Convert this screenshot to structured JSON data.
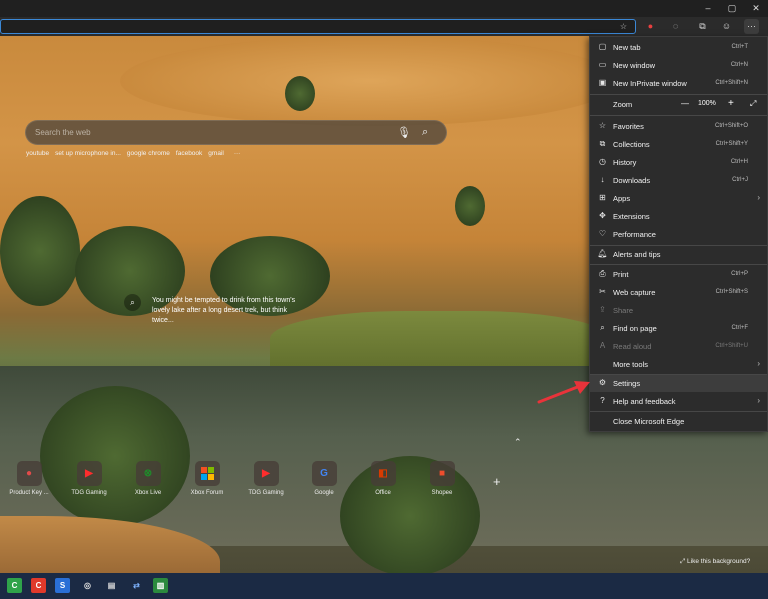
{
  "window": {
    "minimize": "–",
    "restore": "▢",
    "close": "✕"
  },
  "search": {
    "placeholder": "Search the web",
    "quick_links": [
      "youtube",
      "set up microphone in...",
      "google chrome",
      "facebook",
      "gmail",
      "···"
    ]
  },
  "caption": {
    "text": "You might be tempted to drink from this town's lovely lake after a long desert trek, but think twice..."
  },
  "tiles": [
    {
      "label": "Product Key ...",
      "icon": "product-key-icon",
      "color": "#e24a4a"
    },
    {
      "label": "TDG Gaming",
      "icon": "youtube-icon",
      "color": "#ff2d2d"
    },
    {
      "label": "Xbox Live",
      "icon": "xbox-icon",
      "color": "#1f8b2a"
    },
    {
      "label": "Xbox Forum",
      "icon": "microsoft-icon",
      "color": "#f25022"
    },
    {
      "label": "TDG Gaming",
      "icon": "youtube-icon",
      "color": "#ff2d2d"
    },
    {
      "label": "Google",
      "icon": "google-icon",
      "color": "#4285f4"
    },
    {
      "label": "Office",
      "icon": "office-icon",
      "color": "#d83b01"
    },
    {
      "label": "Shopee",
      "icon": "shopee-icon",
      "color": "#ee4d2d"
    }
  ],
  "like_background": "Like this background?",
  "menu": {
    "items": [
      {
        "label": "New tab",
        "shortcut": "Ctrl+T"
      },
      {
        "label": "New window",
        "shortcut": "Ctrl+N"
      },
      {
        "label": "New InPrivate window",
        "shortcut": "Ctrl+Shift+N"
      },
      {
        "label": "Zoom",
        "value": "100%",
        "minus": "—",
        "plus": "+",
        "expand": "⤢"
      },
      {
        "label": "Favorites",
        "shortcut": "Ctrl+Shift+O"
      },
      {
        "label": "Collections",
        "shortcut": "Ctrl+Shift+Y"
      },
      {
        "label": "History",
        "shortcut": "Ctrl+H"
      },
      {
        "label": "Downloads",
        "shortcut": "Ctrl+J"
      },
      {
        "label": "Apps",
        "shortcut": ""
      },
      {
        "label": "Extensions",
        "shortcut": ""
      },
      {
        "label": "Performance",
        "shortcut": ""
      },
      {
        "label": "Alerts and tips",
        "shortcut": ""
      },
      {
        "label": "Print",
        "shortcut": "Ctrl+P"
      },
      {
        "label": "Web capture",
        "shortcut": "Ctrl+Shift+S"
      },
      {
        "label": "Share",
        "shortcut": ""
      },
      {
        "label": "Find on page",
        "shortcut": "Ctrl+F"
      },
      {
        "label": "Read aloud",
        "shortcut": "Ctrl+Shift+U"
      },
      {
        "label": "More tools",
        "shortcut": ""
      },
      {
        "label": "Settings",
        "shortcut": ""
      },
      {
        "label": "Help and feedback",
        "shortcut": ""
      },
      {
        "label": "Close Microsoft Edge",
        "shortcut": ""
      }
    ]
  },
  "colors": {
    "accent": "#3b88d6",
    "arrow": "#e8333a",
    "taskbar": "#1b2a44"
  }
}
